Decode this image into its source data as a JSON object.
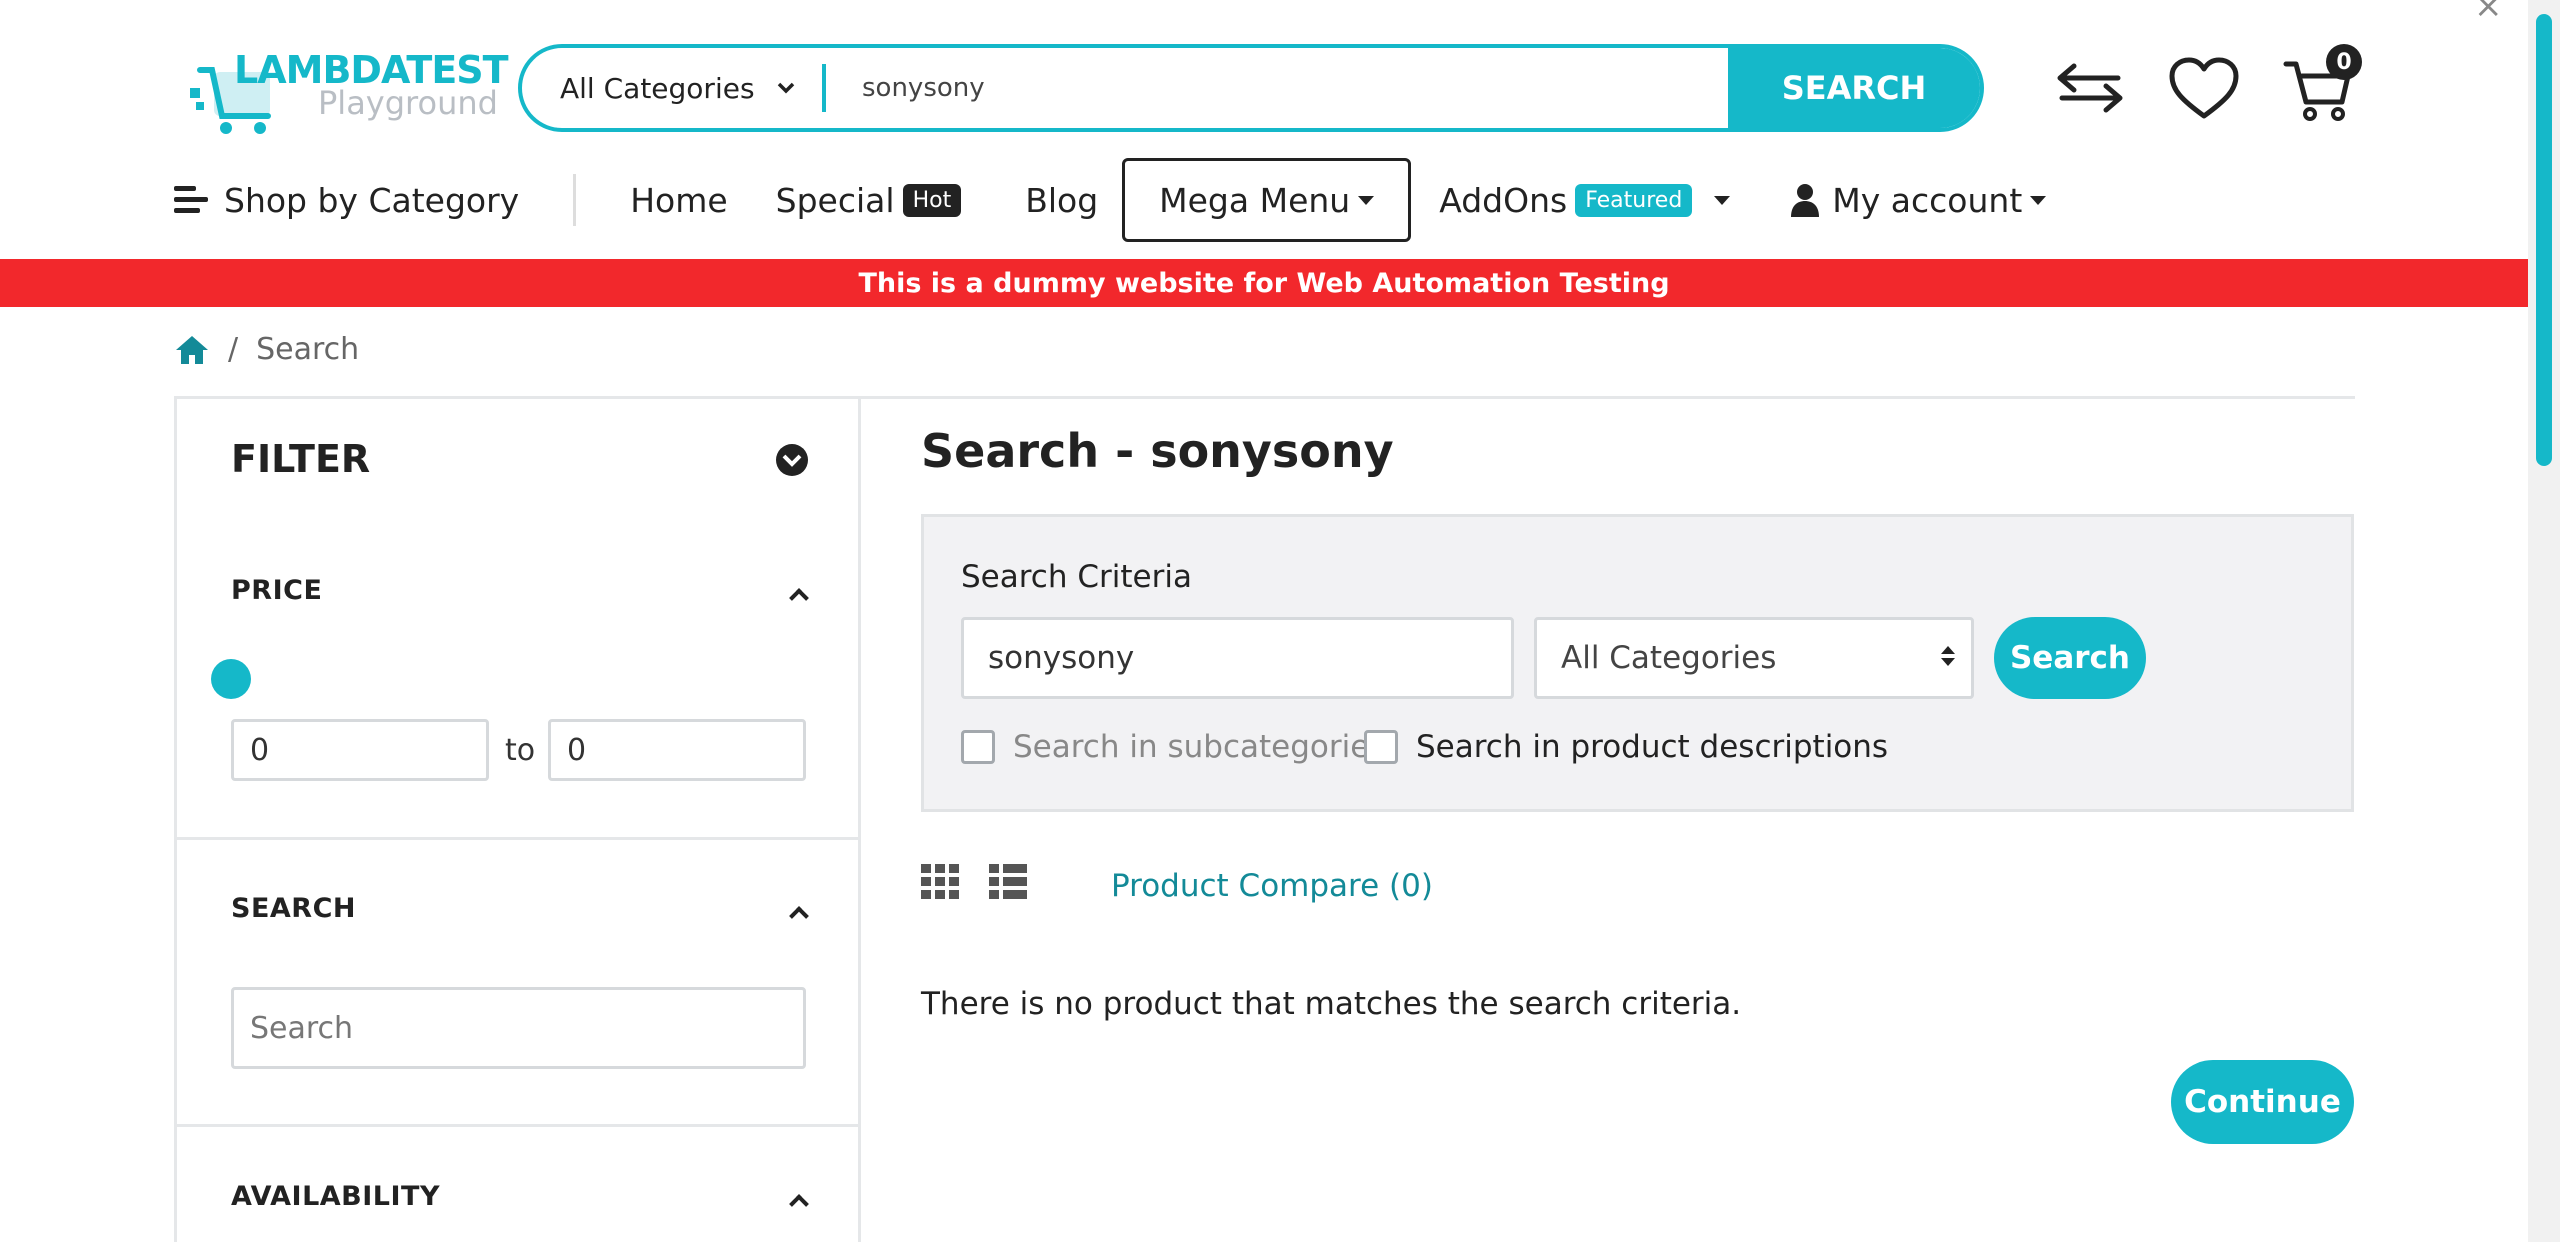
{
  "header": {
    "logo_line1": "LAMBDATEST",
    "logo_line2": "Playground",
    "search": {
      "category": "All Categories",
      "value": "sonysony",
      "button": "SEARCH"
    },
    "cart_count": "0",
    "icons": [
      "compare-icon",
      "wishlist-icon",
      "cart-icon"
    ]
  },
  "nav": {
    "shop_by_category": "Shop by Category",
    "home": "Home",
    "special": "Special",
    "special_badge": "Hot",
    "blog": "Blog",
    "mega_menu": "Mega Menu",
    "addons": "AddOns",
    "addons_badge": "Featured",
    "my_account": "My account"
  },
  "banner": "This is a dummy website for Web Automation Testing",
  "breadcrumb": {
    "current": "Search"
  },
  "sidebar": {
    "title": "FILTER",
    "price_title": "PRICE",
    "price_min": "0",
    "price_to": "to",
    "price_max": "0",
    "search_title": "SEARCH",
    "search_placeholder": "Search",
    "availability_title": "AVAILABILITY"
  },
  "main": {
    "title": "Search - sonysony",
    "criteria_label": "Search Criteria",
    "criteria_value": "sonysony",
    "criteria_category": "All Categories",
    "criteria_button": "Search",
    "subcategories_label": "Search in subcategories",
    "descriptions_label": "Search in product descriptions",
    "compare_link": "Product Compare (0)",
    "no_product": "There is no product that matches the search criteria.",
    "continue_button": "Continue"
  },
  "colors": {
    "accent": "#15b8c9",
    "banner": "#f2282c"
  }
}
